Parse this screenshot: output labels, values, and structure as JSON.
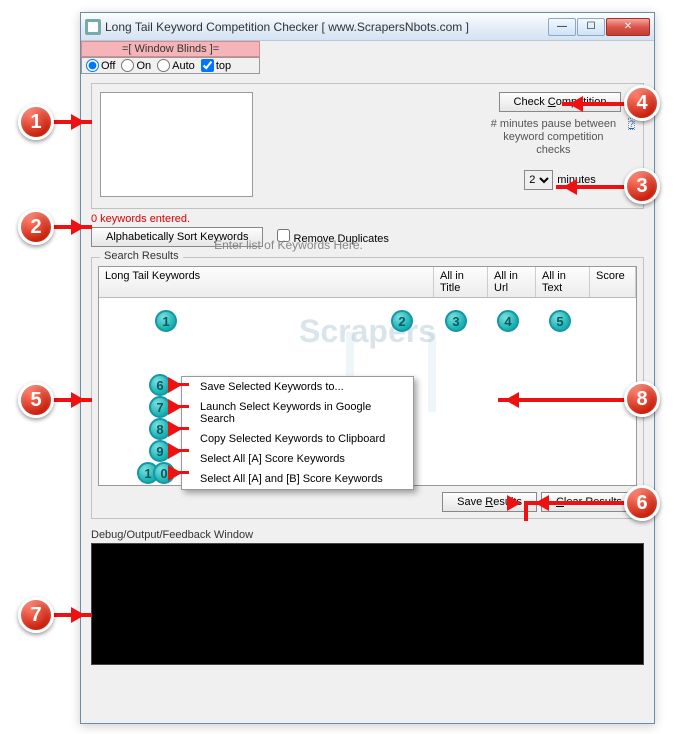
{
  "title": "Long Tail Keyword Competition Checker  [ www.ScrapersNbots.com ]",
  "blinds": {
    "title": "=[ Window Blinds ]=",
    "off": "Off",
    "on": "On",
    "auto": "Auto",
    "top": "top"
  },
  "kw_placeholder": "Enter list of Keywords Here.",
  "check_btn": "Check Competition",
  "pause_text": "# minutes pause between keyword competition checks",
  "help": "?",
  "minutes_val": "2",
  "minutes_lbl": "minutes",
  "kw_count": "0 keywords entered.",
  "sort_btn": "Alphabetically Sort Keywords",
  "remove_dup": "Remove Duplicates",
  "results_title": "Search Results",
  "cols": {
    "kw": "Long Tail Keywords",
    "title": "All in Title",
    "url": "All in Url",
    "text": "All in Text",
    "score": "Score"
  },
  "watermark": "Scrapers",
  "ctx": {
    "i1": "Save Selected Keywords to...",
    "i2": "Launch Select Keywords in Google Search",
    "i3": "Copy Selected Keywords to Clipboard",
    "i4": "Select All [A] Score Keywords",
    "i5": "Select All [A] and [B] Score Keywords"
  },
  "save_results": "Save Results",
  "clear_results": "Clear Results",
  "debug_label": "Debug/Output/Feedback Window"
}
